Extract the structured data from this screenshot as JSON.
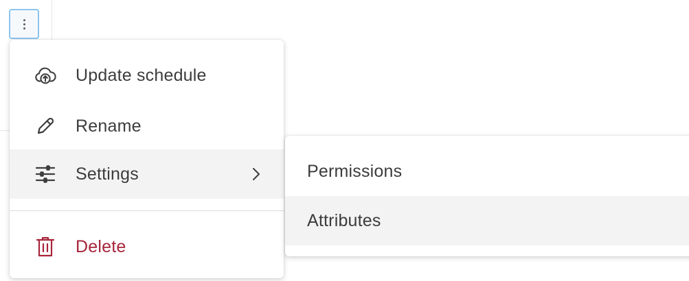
{
  "menu": {
    "items": [
      {
        "label": "Update schedule",
        "icon": "cloud-upload-icon"
      },
      {
        "label": "Rename",
        "icon": "pencil-icon"
      },
      {
        "label": "Settings",
        "icon": "sliders-icon",
        "has_submenu": true,
        "active": true
      },
      {
        "label": "Delete",
        "icon": "trash-icon",
        "danger": true
      }
    ]
  },
  "submenu": {
    "items": [
      {
        "label": "Permissions"
      },
      {
        "label": "Attributes",
        "hovered": true
      }
    ]
  },
  "colors": {
    "text": "#3c3c3c",
    "danger": "#a6243a",
    "active_bg": "#f3f3f3",
    "focus_ring": "#8cc4ee"
  }
}
